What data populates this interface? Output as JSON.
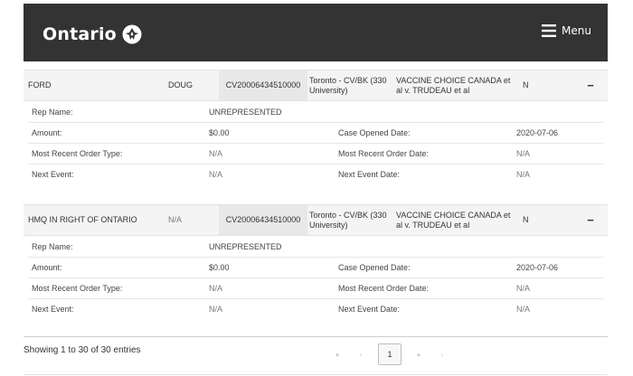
{
  "header": {
    "brand": "Ontario",
    "menu_label": "Menu"
  },
  "records": [
    {
      "last_name": "FORD",
      "first_name": "DOUG",
      "case_number": "CV20006434510000",
      "location": "Toronto - CV/BK (330 University)",
      "case_title": "VACCINE CHOICE CANADA et al v. TRUDEAU et al",
      "flag": "N",
      "toggle": "−",
      "details": {
        "rep_name_label": "Rep Name:",
        "rep_name": "UNREPRESENTED",
        "amount_label": "Amount:",
        "amount": "$0.00",
        "case_opened_label": "Case Opened Date:",
        "case_opened": "2020-07-06",
        "order_type_label": "Most Recent Order Type:",
        "order_type": "N/A",
        "order_date_label": "Most Recent Order Date:",
        "order_date": "N/A",
        "next_event_label": "Next Event:",
        "next_event": "N/A",
        "next_event_date_label": "Next Event Date:",
        "next_event_date": "N/A"
      }
    },
    {
      "last_name": "HMQ IN RIGHT OF ONTARIO",
      "first_name": "N/A",
      "case_number": "CV20006434510000",
      "location": "Toronto - CV/BK (330 University)",
      "case_title": "VACCINE CHOICE CANADA et al v. TRUDEAU et al",
      "flag": "N",
      "toggle": "−",
      "details": {
        "rep_name_label": "Rep Name:",
        "rep_name": "UNREPRESENTED",
        "amount_label": "Amount:",
        "amount": "$0.00",
        "case_opened_label": "Case Opened Date:",
        "case_opened": "2020-07-06",
        "order_type_label": "Most Recent Order Type:",
        "order_type": "N/A",
        "order_date_label": "Most Recent Order Date:",
        "order_date": "N/A",
        "next_event_label": "Next Event:",
        "next_event": "N/A",
        "next_event_date_label": "Next Event Date:",
        "next_event_date": "N/A"
      }
    }
  ],
  "footer": {
    "showing": "Showing 1 to 30 of 30 entries",
    "current_page": "1",
    "first_icon": "double-chevron-left-icon",
    "prev_icon": "chevron-left-icon",
    "next_icon": "chevron-right-icon",
    "last_icon": "double-chevron-right-icon"
  }
}
